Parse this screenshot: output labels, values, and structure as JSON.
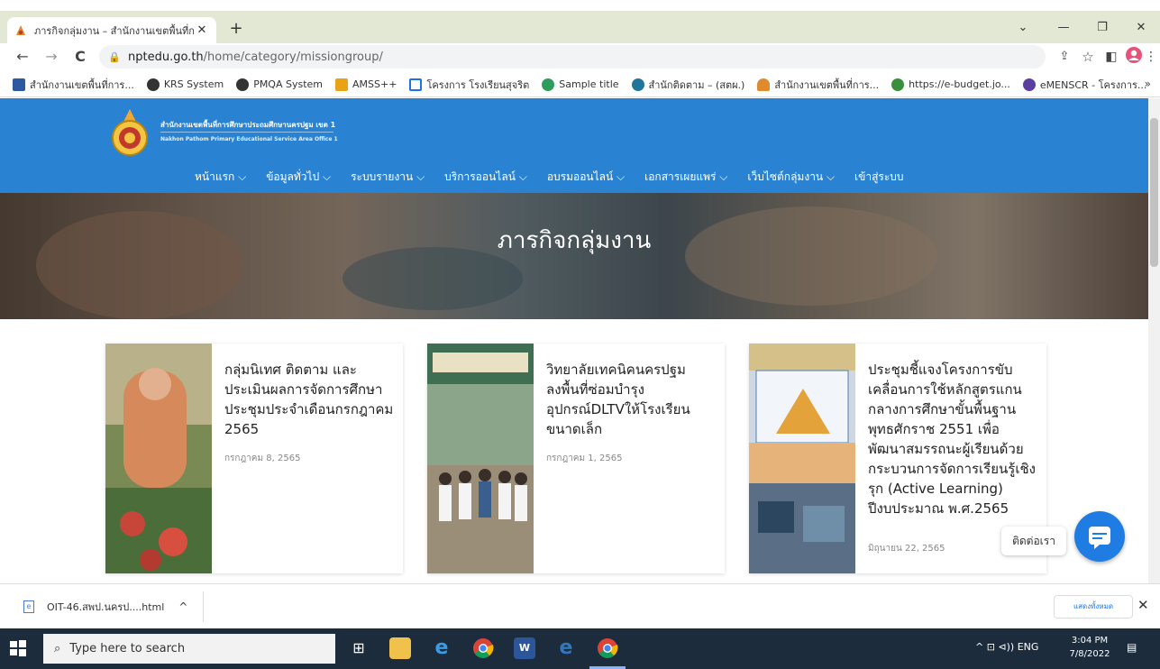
{
  "browser": {
    "tab_title": "ภารกิจกลุ่มงาน – สำนักงานเขตพื้นที่การ",
    "tab_close": "✕",
    "new_tab": "+",
    "window_controls": {
      "minimize": "—",
      "restore": "❐",
      "close": "✕",
      "tab_search": "⌄"
    },
    "url_host": "nptedu.go.th",
    "url_path": "/home/category/missiongroup/",
    "nav": {
      "back": "←",
      "forward": "→",
      "reload": "C"
    }
  },
  "bookmarks": [
    {
      "label": "สำนักงานเขตพื้นที่การ...",
      "icon": "am-icon",
      "color": "#2c5aa0"
    },
    {
      "label": "KRS System",
      "icon": "globe-icon",
      "color": "#333333"
    },
    {
      "label": "PMQA System",
      "icon": "globe-icon",
      "color": "#333333"
    },
    {
      "label": "AMSS++",
      "icon": "amss-icon",
      "color": "#e8a317"
    },
    {
      "label": "โครงการ โรงเรียนสุจริต",
      "icon": "calendar-icon",
      "color": "#1a73e8"
    },
    {
      "label": "Sample title",
      "icon": "sample-icon",
      "color": "#2e9d5b"
    },
    {
      "label": "สำนักติดตาม – (สตผ.)",
      "icon": "wordpress-icon",
      "color": "#21759b"
    },
    {
      "label": "สำนักงานเขตพื้นที่การ...",
      "icon": "seal-icon",
      "color": "#e08a2e"
    },
    {
      "label": "https://e-budget.jo...",
      "icon": "ebudget-icon",
      "color": "#3a8f3a"
    },
    {
      "label": "eMENSCR - โครงการ...",
      "icon": "emenscr-icon",
      "color": "#5b3fa0"
    }
  ],
  "bookmarks_more": "»",
  "site": {
    "name_th": "สำนักงานเขตพื้นที่การศึกษาประถมศึกษานครปฐม เขต 1",
    "name_en": "Nakhon Pathom Primary Educational Service Area Office 1",
    "nav": [
      "หน้าแรก ⌵",
      "ข้อมูลทั่วไป ⌵",
      "ระบบรายงาน ⌵",
      "บริการออนไลน์ ⌵",
      "อบรมออนไลน์ ⌵",
      "เอกสารเผยแพร่ ⌵",
      "เว็บไซต์กลุ่มงาน ⌵",
      "เข้าสู่ระบบ"
    ],
    "header_color": "#2a83d2",
    "banner_title": "ภารกิจกลุ่มงาน"
  },
  "cards": [
    {
      "title": "กลุ่มนิเทศ ติดตาม และประเมินผลการจัดการศึกษา ประชุมประจำเดือนกรกฎาคม 2565",
      "date": "กรกฎาคม 8, 2565"
    },
    {
      "title": "วิทยาลัยเทคนิคนครปฐม ลงพื้นที่ซ่อมบำรุง อุปกรณ์DLTVให้โรงเรียนขนาดเล็ก",
      "date": "กรกฎาคม 1, 2565"
    },
    {
      "title": "ประชุมชี้แจงโครงการขับเคลื่อนการใช้หลักสูตรแกนกลางการศึกษาขั้นพื้นฐาน พุทธศักราช 2551 เพื่อพัฒนาสมรรถนะผู้เรียนด้วยกระบวนการจัดการเรียนรู้เชิงรุก (Active Learning) ปีงบประมาณ พ.ศ.2565",
      "date": "มิถุนายน 22, 2565"
    }
  ],
  "chat": {
    "label": "ติดต่อเรา",
    "color": "#1f7ce3"
  },
  "downloads": {
    "filename": "OIT-46.สพป.นครป....html",
    "chevron": "^",
    "show_all": "แสดงทั้งหมด",
    "close": "✕"
  },
  "taskbar": {
    "search_placeholder": "Type here to search",
    "tray": "^  ⊡  ⊲))  ENG",
    "time": "3:04 PM",
    "date": "7/8/2022"
  }
}
